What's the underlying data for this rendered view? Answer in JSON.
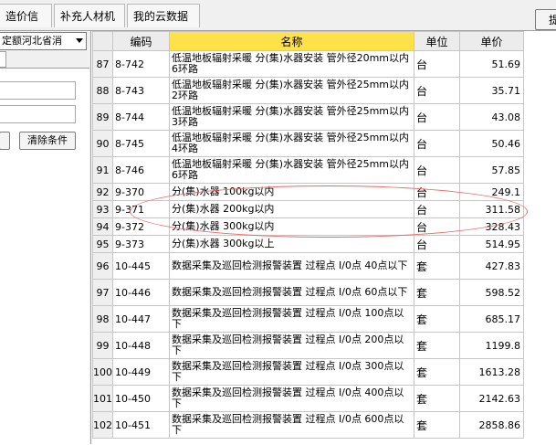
{
  "tabs": [
    "造价信息",
    "补充人材机",
    "我的云数据"
  ],
  "corner_button": "提",
  "left_panel": {
    "region_value": "定额河北省消",
    "clear_button": "清除条件"
  },
  "grid": {
    "columns": {
      "code": "编码",
      "name": "名称",
      "unit": "单位",
      "price": "单价"
    },
    "rows": [
      {
        "idx": "87",
        "code": "8-742",
        "name": "低温地板辐射采暖 分(集)水器安装 管外径20mm以内 6环路",
        "unit": "台",
        "price": "51.69"
      },
      {
        "idx": "88",
        "code": "8-743",
        "name": "低温地板辐射采暖 分(集)水器安装 管外径25mm以内 2环路",
        "unit": "台",
        "price": "35.71"
      },
      {
        "idx": "89",
        "code": "8-744",
        "name": "低温地板辐射采暖 分(集)水器安装 管外径25mm以内 3环路",
        "unit": "台",
        "price": "43.08"
      },
      {
        "idx": "90",
        "code": "8-745",
        "name": "低温地板辐射采暖 分(集)水器安装 管外径25mm以内 4环路",
        "unit": "台",
        "price": "50.46"
      },
      {
        "idx": "91",
        "code": "8-746",
        "name": "低温地板辐射采暖 分(集)水器安装 管外径25mm以内 6环路",
        "unit": "台",
        "price": "57.85"
      },
      {
        "idx": "92",
        "code": "9-370",
        "name": "分(集)水器 100kg以内",
        "unit": "台",
        "price": "249.1"
      },
      {
        "idx": "93",
        "code": "9-371",
        "name": "分(集)水器 200kg以内",
        "unit": "台",
        "price": "311.58"
      },
      {
        "idx": "94",
        "code": "9-372",
        "name": "分(集)水器 300kg以内",
        "unit": "台",
        "price": "328.43"
      },
      {
        "idx": "95",
        "code": "9-373",
        "name": "分(集)水器 300kg以上",
        "unit": "台",
        "price": "514.95"
      },
      {
        "idx": "96",
        "code": "10-445",
        "name": "数据采集及巡回检测报警装置 过程点 I/0点 40点以下",
        "unit": "套",
        "price": "427.83"
      },
      {
        "idx": "97",
        "code": "10-446",
        "name": "数据采集及巡回检测报警装置 过程点 I/0点 60点以下",
        "unit": "套",
        "price": "598.52"
      },
      {
        "idx": "98",
        "code": "10-447",
        "name": "数据采集及巡回检测报警装置 过程点 I/0点 100点以下",
        "unit": "套",
        "price": "685.17"
      },
      {
        "idx": "99",
        "code": "10-448",
        "name": "数据采集及巡回检测报警装置 过程点 I/0点 200点以下",
        "unit": "套",
        "price": "1199.8"
      },
      {
        "idx": "100",
        "code": "10-449",
        "name": "数据采集及巡回检测报警装置 过程点 I/0点 300点以下",
        "unit": "套",
        "price": "1613.28"
      },
      {
        "idx": "101",
        "code": "10-450",
        "name": "数据采集及巡回检测报警装置 过程点 I/0点 400点以下",
        "unit": "套",
        "price": "2142.63"
      },
      {
        "idx": "102",
        "code": "10-451",
        "name": "数据采集及巡回检测报警装置 过程点 I/0点 600点以下",
        "unit": "套",
        "price": "2858.86"
      }
    ]
  },
  "colors": {
    "header_highlight": "#ffe24a",
    "annotation": "#e46a6a"
  }
}
